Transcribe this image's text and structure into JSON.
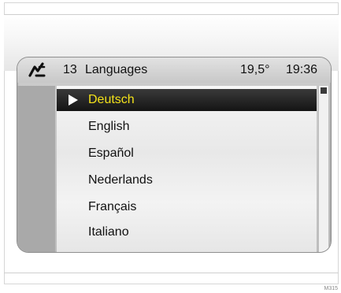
{
  "status_bar": {
    "menu_number": "13",
    "menu_title": "Languages",
    "temperature": "19,5°",
    "clock": "19:36",
    "icon": "menu-symbol-icon"
  },
  "languages": [
    {
      "label": "Deutsch",
      "selected": true
    },
    {
      "label": "English",
      "selected": false
    },
    {
      "label": "Español",
      "selected": false
    },
    {
      "label": "Nederlands",
      "selected": false
    },
    {
      "label": "Français",
      "selected": false
    },
    {
      "label": "Italiano",
      "selected": false
    }
  ],
  "colors": {
    "selected_text": "#f3e21a",
    "selected_bg": "#1a1a1a",
    "screen_bg": "#bdbdbd"
  },
  "ref_code": "M315"
}
